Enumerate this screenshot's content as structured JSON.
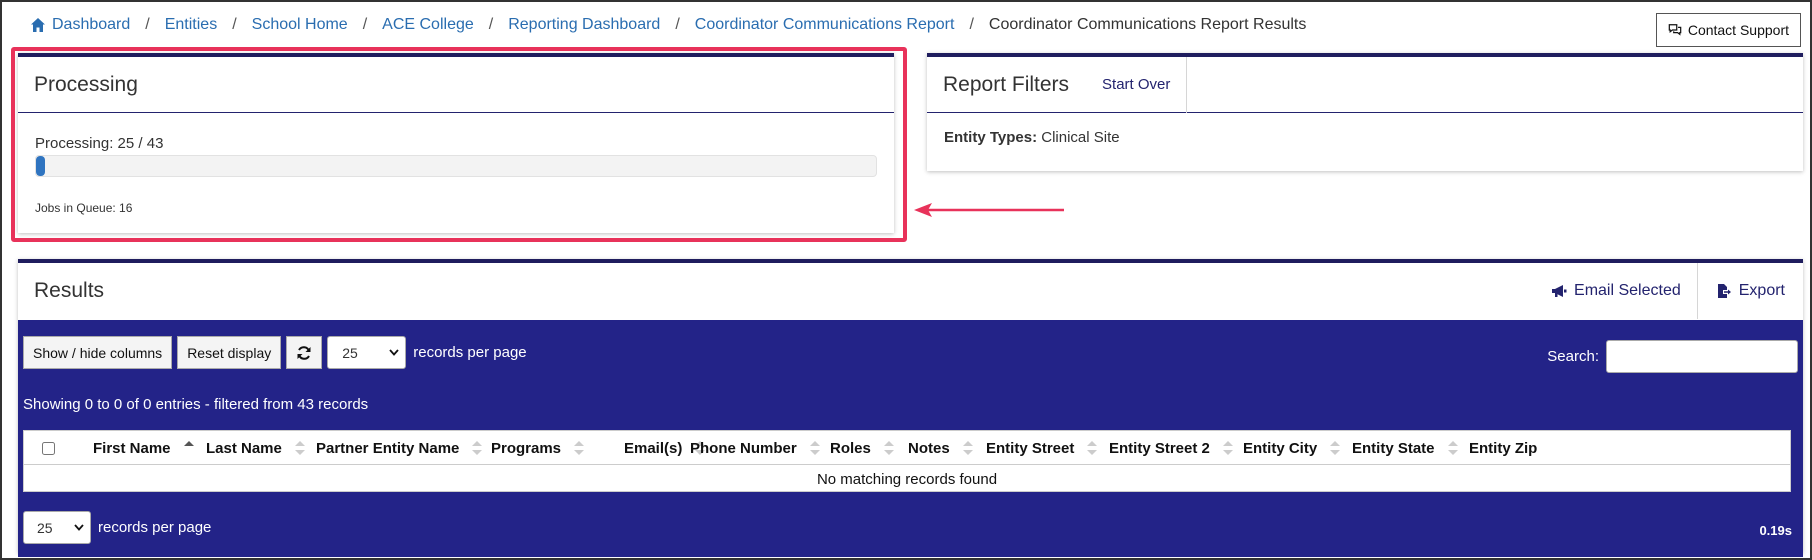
{
  "breadcrumb": {
    "items": [
      "Dashboard",
      "Entities",
      "School Home",
      "ACE College",
      "Reporting Dashboard",
      "Coordinator Communications Report"
    ],
    "current": "Coordinator Communications Report Results",
    "separator": "/"
  },
  "header": {
    "contact_support": "Contact Support"
  },
  "processing": {
    "title": "Processing",
    "label": "Processing: 25 / 43",
    "progress_fraction": 0.0108,
    "queue": "Jobs in Queue: 16"
  },
  "filters": {
    "title": "Report Filters",
    "start_over": "Start Over",
    "entity_types_label": "Entity Types:",
    "entity_types_value": "Clinical Site"
  },
  "results": {
    "title": "Results",
    "email_selected": "Email Selected",
    "export": "Export",
    "show_hide": "Show / hide columns",
    "reset": "Reset display",
    "records_per_page_value": "25",
    "records_per_page_label": "records per page",
    "search_label": "Search:",
    "search_value": "",
    "info": "Showing 0 to 0 of 0 entries - filtered from 43 records",
    "columns": [
      "First Name",
      "Last Name",
      "Partner Entity Name",
      "Programs",
      "Email(s)",
      "Phone Number",
      "Roles",
      "Notes",
      "Entity Street",
      "Entity Street 2",
      "Entity City",
      "Entity State",
      "Entity Zip"
    ],
    "empty_message": "No matching records found",
    "timing": "0.19s"
  },
  "colors": {
    "accent": "#232388",
    "highlight": "#e8325a",
    "link": "#2a6db0",
    "progress": "#2f74c0"
  }
}
